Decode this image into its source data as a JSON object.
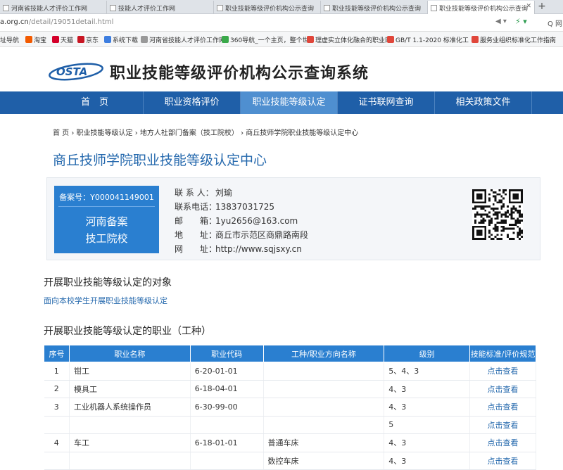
{
  "browser": {
    "tabs": [
      {
        "label": "河南省技能人才评价工作网",
        "active": false
      },
      {
        "label": "技能人才评价工作网",
        "active": false
      },
      {
        "label": "职业技能等级评价机构公示查询",
        "active": false
      },
      {
        "label": "职业技能等级评价机构公示查询",
        "active": false
      },
      {
        "label": "职业技能等级评价机构公示查询",
        "active": true
      }
    ],
    "url_host": "a.org.cn",
    "url_path": "/detail/19051detail.html",
    "addr_right_1": "◀ ▾",
    "addr_right_2": "⚡ ▾",
    "addr_right_3": "Q 网",
    "bookmarks": [
      {
        "label": "址导航",
        "color": "#e04b2a"
      },
      {
        "label": "淘宝",
        "color": "#f25a00"
      },
      {
        "label": "天猫",
        "color": "#d4002a"
      },
      {
        "label": "京东",
        "color": "#c81623"
      },
      {
        "label": "系统下载",
        "color": "#3d7ee0"
      },
      {
        "label": "河南省技能人才评价工作网",
        "color": "#999999"
      },
      {
        "label": "360导航_一个主页，整个世",
        "color": "#3aa94a"
      },
      {
        "label": "理虚实立体化融合的职业网",
        "color": "#e0463a"
      },
      {
        "label": "GB/T 1.1-2020 标准化工",
        "color": "#e0463a"
      },
      {
        "label": "服务业组织标准化工作指南",
        "color": "#e0463a"
      }
    ]
  },
  "site": {
    "logo_text": "OSTA",
    "title": "职业技能等级评价机构公示查询系统",
    "nav": [
      {
        "label": "首　页",
        "active": false
      },
      {
        "label": "职业资格评价",
        "active": false
      },
      {
        "label": "职业技能等级认定",
        "active": true
      },
      {
        "label": "证书联网查询",
        "active": false
      },
      {
        "label": "相关政策文件",
        "active": false
      }
    ]
  },
  "breadcrumb": "首 页 › 职业技能等级认定 › 地方人社部门备案（技工院校） › 商丘技师学院职业技能等级认定中心",
  "page_title": "商丘技师学院职业技能等级认定中心",
  "org": {
    "record_no": "备案号：Y000041149001",
    "badge_line1": "河南备案",
    "badge_line2": "技工院校",
    "contact_label": "联 系 人：",
    "contact": "刘瑜",
    "phone_label": "联系电话：",
    "phone": "13837031725",
    "email_label": "邮　　箱：",
    "email": "1yu2656@163.com",
    "address_label": "地　　址：",
    "address": "商丘市示范区商鼎路南段",
    "website_label": "网　　址：",
    "website": "http://www.sqjsxy.cn"
  },
  "section_target": {
    "heading": "开展职业技能等级认定的对象",
    "text": "面向本校学生开展职业技能等级认定"
  },
  "section_occupations": {
    "heading": "开展职业技能等级认定的职业（工种）",
    "columns": [
      "序号",
      "职业名称",
      "职业代码",
      "工种/职业方向名称",
      "级别",
      "技能标准/评价规范"
    ],
    "rows": [
      {
        "no": "1",
        "name": "钳工",
        "code": "6-20-01-01",
        "direction": "",
        "level": "5、4、3",
        "link": "点击查看"
      },
      {
        "no": "2",
        "name": "模具工",
        "code": "6-18-04-01",
        "direction": "",
        "level": "4、3",
        "link": "点击查看"
      },
      {
        "no": "3",
        "name": "工业机器人系统操作员",
        "code": "6-30-99-00",
        "direction": "",
        "level": "4、3",
        "link": "点击查看"
      },
      {
        "no": "",
        "name": "",
        "code": "",
        "direction": "",
        "level": "5",
        "link": "点击查看"
      },
      {
        "no": "4",
        "name": "车工",
        "code": "6-18-01-01",
        "direction": "普通车床",
        "level": "4、3",
        "link": "点击查看"
      },
      {
        "no": "",
        "name": "",
        "code": "",
        "direction": "数控车床",
        "level": "4、3",
        "link": "点击查看"
      }
    ]
  }
}
